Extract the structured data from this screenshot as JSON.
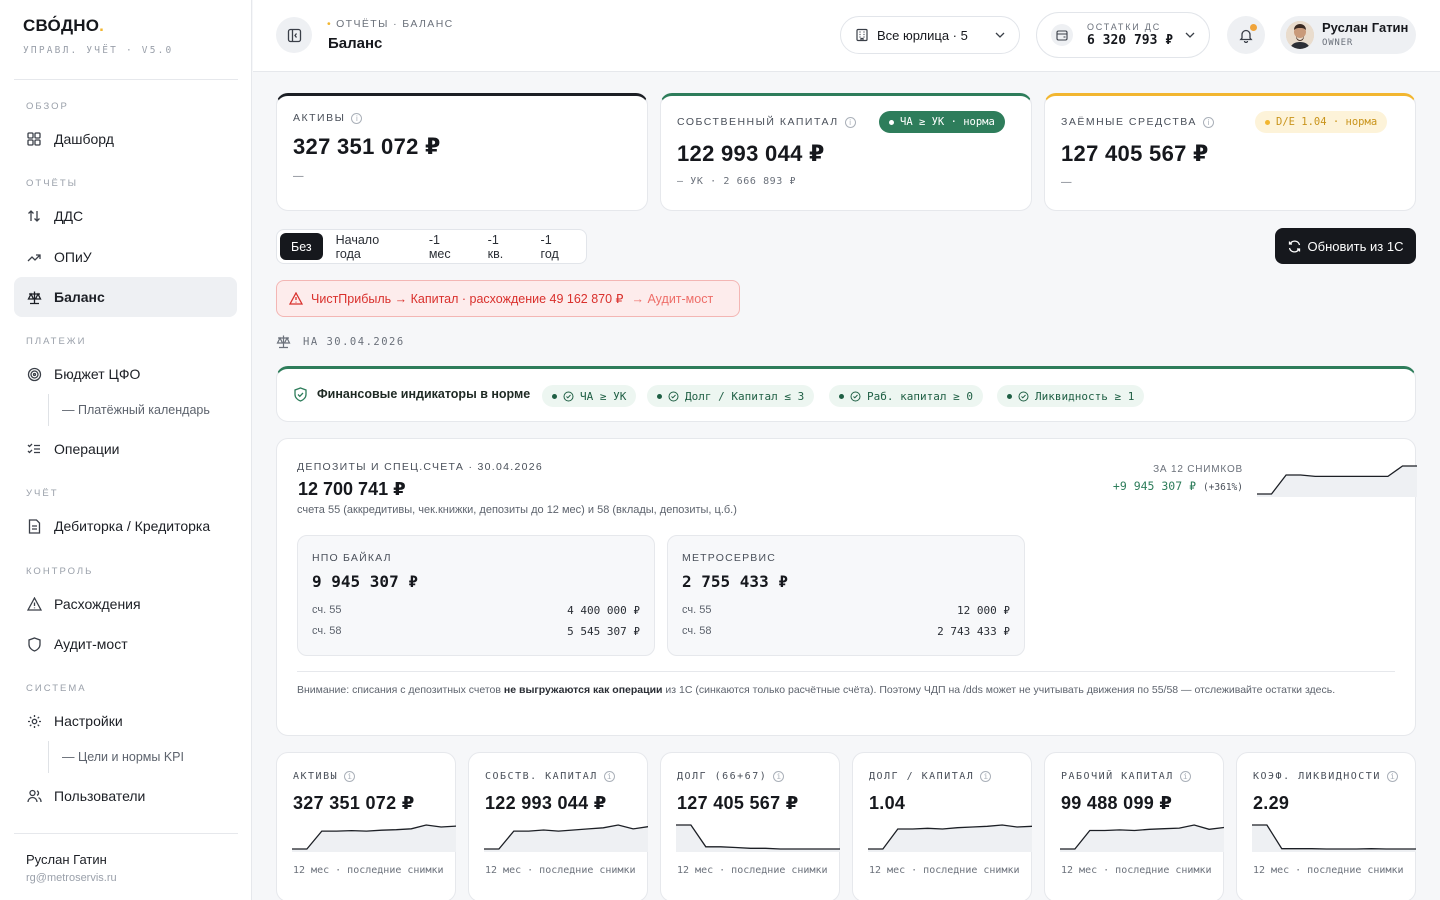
{
  "brand": {
    "name": "СВО́ДНО",
    "dot": ".",
    "subtitle": "УПРАВЛ. УЧЁТ · V5.0"
  },
  "sidebar": {
    "sections": [
      {
        "title": "ОБЗОР"
      },
      {
        "title": "ОТЧЁТЫ"
      },
      {
        "title": "ПЛАТЕЖИ"
      },
      {
        "title": "УЧЁТ"
      },
      {
        "title": "КОНТРОЛЬ"
      },
      {
        "title": "СИСТЕМА"
      }
    ],
    "items": [
      {
        "label": "Дашборд"
      },
      {
        "label": "ДДС"
      },
      {
        "label": "ОПиУ"
      },
      {
        "label": "Баланс"
      },
      {
        "label": "Бюджет ЦФО"
      },
      {
        "label": "— Платёжный календарь"
      },
      {
        "label": "Операции"
      },
      {
        "label": "Дебиторка / Кредиторка"
      },
      {
        "label": "Расхождения"
      },
      {
        "label": "Аудит-мост"
      },
      {
        "label": "Настройки"
      },
      {
        "label": "— Цели и нормы KPI"
      },
      {
        "label": "Пользователи"
      }
    ],
    "user_name": "Руслан Гатин",
    "user_email": "rg@metroservis.ru"
  },
  "header": {
    "crumb": "ОТЧЁТЫ · БАЛАНС",
    "title": "Баланс",
    "entity_selector": "Все юрлица · 5",
    "cash_label": "ОСТАТКИ ДС",
    "cash_value": "6 320 793 ₽",
    "user_name": "Руслан Гатин",
    "user_role": "OWNER"
  },
  "kpis": {
    "assets": {
      "label": "АКТИВЫ",
      "value": "327 351 072 ₽",
      "sub": "—"
    },
    "equity": {
      "label": "СОБСТВЕННЫЙ КАПИТАЛ",
      "value": "122 993 044 ₽",
      "sub": "— УК · 2 666 893 ₽",
      "tag": "ЧА ≥ УК · норма"
    },
    "debt": {
      "label": "ЗАЁМНЫЕ СРЕДСТВА",
      "value": "127 405 567 ₽",
      "sub": "—",
      "tag": "D/E 1.04 · норма"
    }
  },
  "periods": [
    "Без",
    "Начало года",
    "-1 мес",
    "-1 кв.",
    "-1 год"
  ],
  "refresh_label": "Обновить из 1С",
  "alert": {
    "text": "ЧистПрибыль → Капитал · расхождение 49 162 870 ₽",
    "link": "→ Аудит-мост"
  },
  "as_of": "НА 30.04.2026",
  "indicators": {
    "title": "Финансовые индикаторы в норме",
    "chips": [
      "ЧА ≥ УК",
      "Долг / Капитал ≤ 3",
      "Раб. капитал ≥ 0",
      "Ликвидность ≥ 1"
    ]
  },
  "deposits": {
    "title": "ДЕПОЗИТЫ И СПЕЦ.СЧЕТА · 30.04.2026",
    "total": "12 700 741 ₽",
    "desc": "счета 55 (аккредитивы, чек.книжки, депозиты до 12 мес) и 58 (вклады, депозиты, ц.б.)",
    "trend_label": "ЗА 12 СНИМКОВ",
    "trend_value": "+9 945 307 ₽",
    "trend_pct": "(+361%)",
    "trend_series": [
      2.76,
      2.76,
      9.5,
      9.5,
      9.0,
      9.0,
      9.0,
      9.0,
      9.0,
      9.0,
      12.7,
      12.7
    ],
    "entities": [
      {
        "name": "НПО БАЙКАЛ",
        "total": "9 945 307 ₽",
        "rows": [
          {
            "acc": "сч. 55",
            "val": "4 400 000 ₽"
          },
          {
            "acc": "сч. 58",
            "val": "5 545 307 ₽"
          }
        ]
      },
      {
        "name": "МЕТРОСЕРВИС",
        "total": "2 755 433 ₽",
        "rows": [
          {
            "acc": "сч. 55",
            "val": "12 000 ₽"
          },
          {
            "acc": "сч. 58",
            "val": "2 743 433 ₽"
          }
        ]
      }
    ],
    "note_pre": "Внимание: списания с депозитных счетов ",
    "note_bold": "не выгружаются как операции",
    "note_post": " из 1С (синкаются только расчётные счёта). Поэтому ЧДП на /dds может не учитывать движения по 55/58 — отслеживайте остатки здесь."
  },
  "minis": [
    {
      "label": "АКТИВЫ",
      "value": "327 351 072 ₽",
      "foot": "12 мес · последние снимки",
      "series": [
        220,
        220,
        300,
        300,
        302,
        300,
        304,
        306,
        310,
        327,
        318,
        322
      ]
    },
    {
      "label": "СОБСТВ. КАПИТАЛ",
      "value": "122 993 044 ₽",
      "foot": "12 мес · последние снимки",
      "series": [
        80,
        80,
        112,
        112,
        114,
        112,
        114,
        116,
        118,
        123,
        116,
        120
      ]
    },
    {
      "label": "ДОЛГ (66+67)",
      "value": "127 405 567 ₽",
      "foot": "12 мес · последние снимки",
      "series": [
        160,
        160,
        130,
        130,
        129,
        128,
        128,
        127,
        127,
        127,
        127,
        127
      ]
    },
    {
      "label": "ДОЛГ / КАПИТАЛ",
      "value": "1.04",
      "foot": "12 мес · последние снимки",
      "series": [
        0.7,
        0.7,
        1.0,
        1.0,
        1.01,
        1.0,
        1.02,
        1.03,
        1.04,
        1.06,
        1.03,
        1.04
      ]
    },
    {
      "label": "РАБОЧИЙ КАПИТАЛ",
      "value": "99 488 099 ₽",
      "foot": "12 мес · последние снимки",
      "series": [
        60,
        60,
        90,
        90,
        91,
        90,
        92,
        93,
        94,
        99,
        92,
        95
      ]
    },
    {
      "label": "КОЭФ. ЛИКВИДНОСТИ",
      "value": "2.29",
      "foot": "12 мес · последние снимки",
      "series": [
        3.2,
        3.2,
        2.3,
        2.3,
        2.3,
        2.29,
        2.29,
        2.29,
        2.3,
        2.29,
        2.29,
        2.29
      ]
    }
  ],
  "colors": {
    "accent_dark": "#16181d",
    "ok_green": "#2e7d5b",
    "warn_yellow": "#f2b630",
    "alert_red": "#d9302c"
  }
}
